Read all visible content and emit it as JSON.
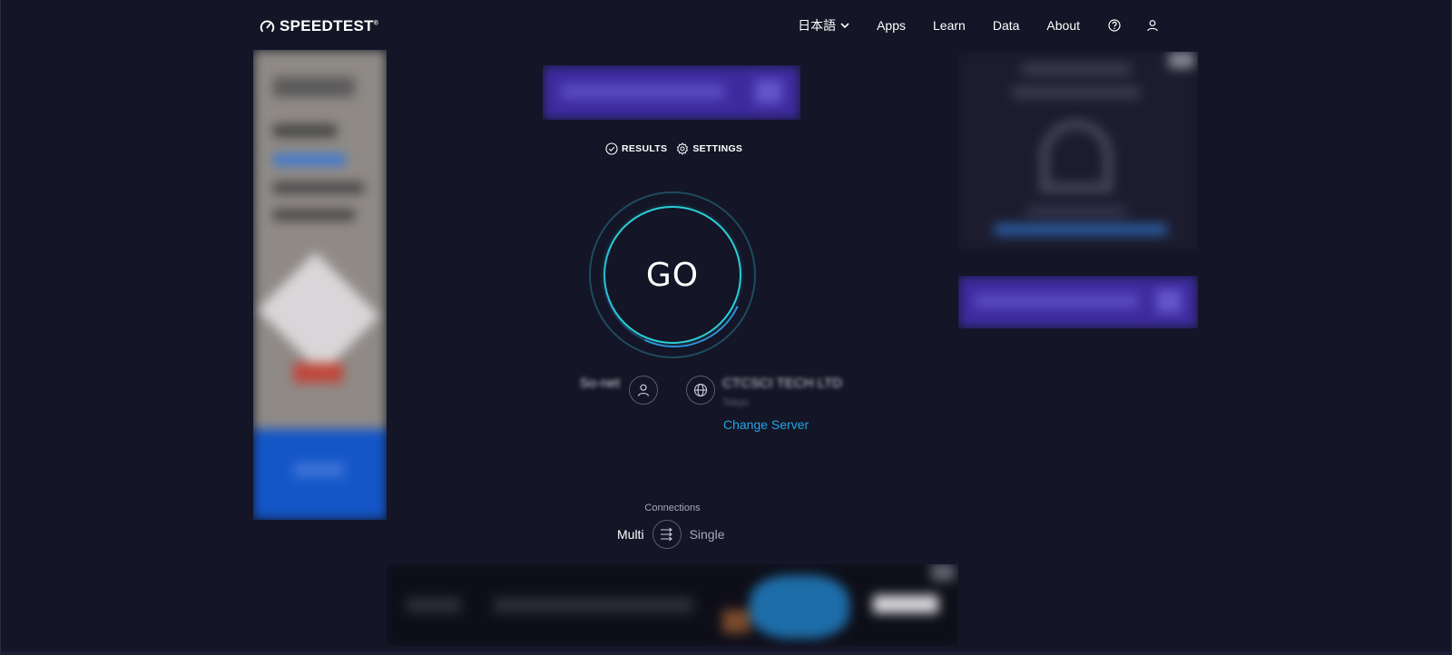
{
  "header": {
    "logo_text": "SPEEDTEST",
    "logo_tm": "®",
    "nav": {
      "language": "日本語",
      "apps": "Apps",
      "learn": "Learn",
      "data": "Data",
      "about": "About"
    }
  },
  "tabs": {
    "results": "RESULTS",
    "settings": "SETTINGS"
  },
  "go_label": "GO",
  "isp": {
    "name": "So-net",
    "ip": ""
  },
  "server": {
    "name": "CTCSCI TECH LTD",
    "location": "Tokyo",
    "change_label": "Change Server"
  },
  "connections": {
    "title": "Connections",
    "multi": "Multi",
    "single": "Single"
  },
  "colors": {
    "background": "#141526",
    "accent_teal": "#29cfd6",
    "link_blue": "#23a4e0"
  }
}
